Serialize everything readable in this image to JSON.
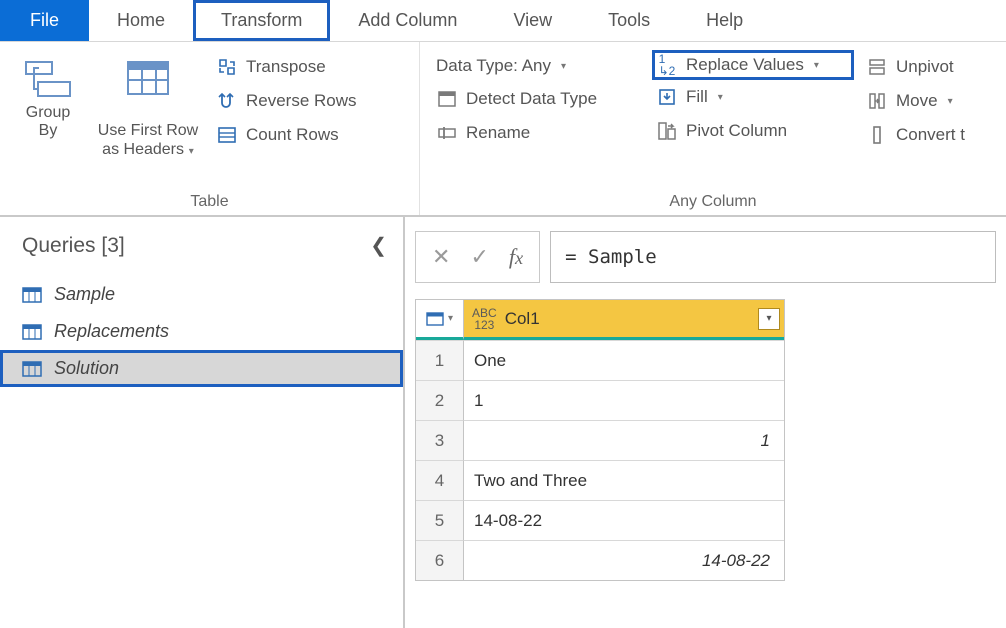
{
  "tabs": {
    "file": "File",
    "home": "Home",
    "transform": "Transform",
    "addcolumn": "Add Column",
    "view": "View",
    "tools": "Tools",
    "help": "Help"
  },
  "ribbon": {
    "table_group": {
      "label": "Table",
      "group_by": "Group\nBy",
      "use_first_row": "Use First Row\nas Headers",
      "transpose": "Transpose",
      "reverse_rows": "Reverse Rows",
      "count_rows": "Count Rows"
    },
    "anycol_group": {
      "label": "Any Column",
      "data_type": "Data Type: Any",
      "detect": "Detect Data Type",
      "rename": "Rename",
      "replace": "Replace Values",
      "fill": "Fill",
      "pivot": "Pivot Column",
      "unpivot": "Unpivot",
      "move": "Move",
      "convert": "Convert t"
    }
  },
  "queries": {
    "title": "Queries [3]",
    "items": [
      {
        "name": "Sample"
      },
      {
        "name": "Replacements"
      },
      {
        "name": "Solution"
      }
    ]
  },
  "formula": "= Sample",
  "grid": {
    "col_header": "Col1",
    "rows": [
      {
        "n": "1",
        "v": "One",
        "italic": false
      },
      {
        "n": "2",
        "v": "1",
        "italic": false
      },
      {
        "n": "3",
        "v": "1",
        "italic": true
      },
      {
        "n": "4",
        "v": "Two and Three",
        "italic": false
      },
      {
        "n": "5",
        "v": "14-08-22",
        "italic": false
      },
      {
        "n": "6",
        "v": "14-08-22",
        "italic": true
      }
    ]
  }
}
